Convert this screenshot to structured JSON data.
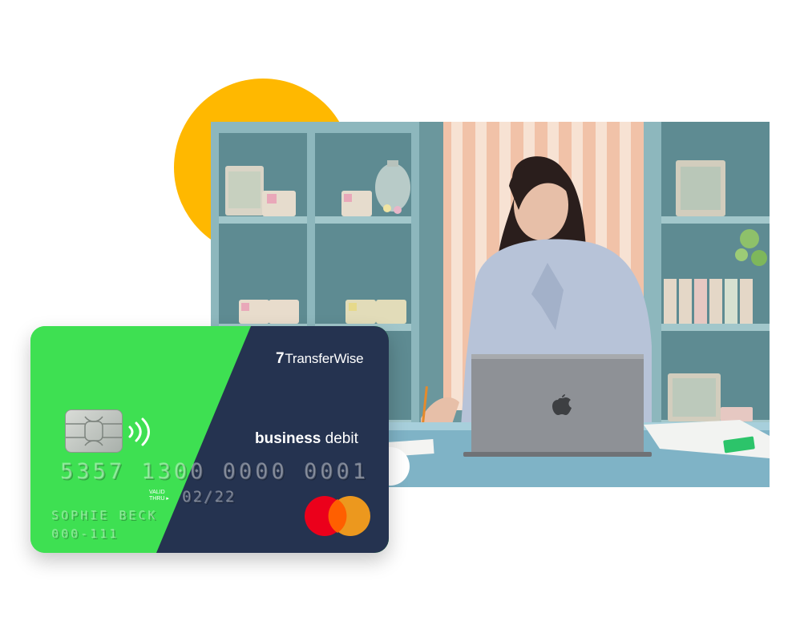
{
  "card": {
    "brand": "TransferWise",
    "brand_mark": "7",
    "product_bold": "business",
    "product_regular": "debit",
    "number": "5357 1300 0000 0001",
    "valid_thru_line1": "VALID",
    "valid_thru_line2": "THRU",
    "expiry": "02/22",
    "holder_name": "SOPHIE BECK",
    "account_code": "000-111",
    "network": "mastercard-logo",
    "colors": {
      "green": "#3EE052",
      "navy": "#253350",
      "mastercard_red": "#EB001B",
      "mastercard_orange": "#F79E1B"
    }
  },
  "decor": {
    "circle_color": "#FFB800"
  },
  "photo": {
    "subject": "woman writing at laptop in shop",
    "laptop_logo": "apple-logo-icon"
  }
}
